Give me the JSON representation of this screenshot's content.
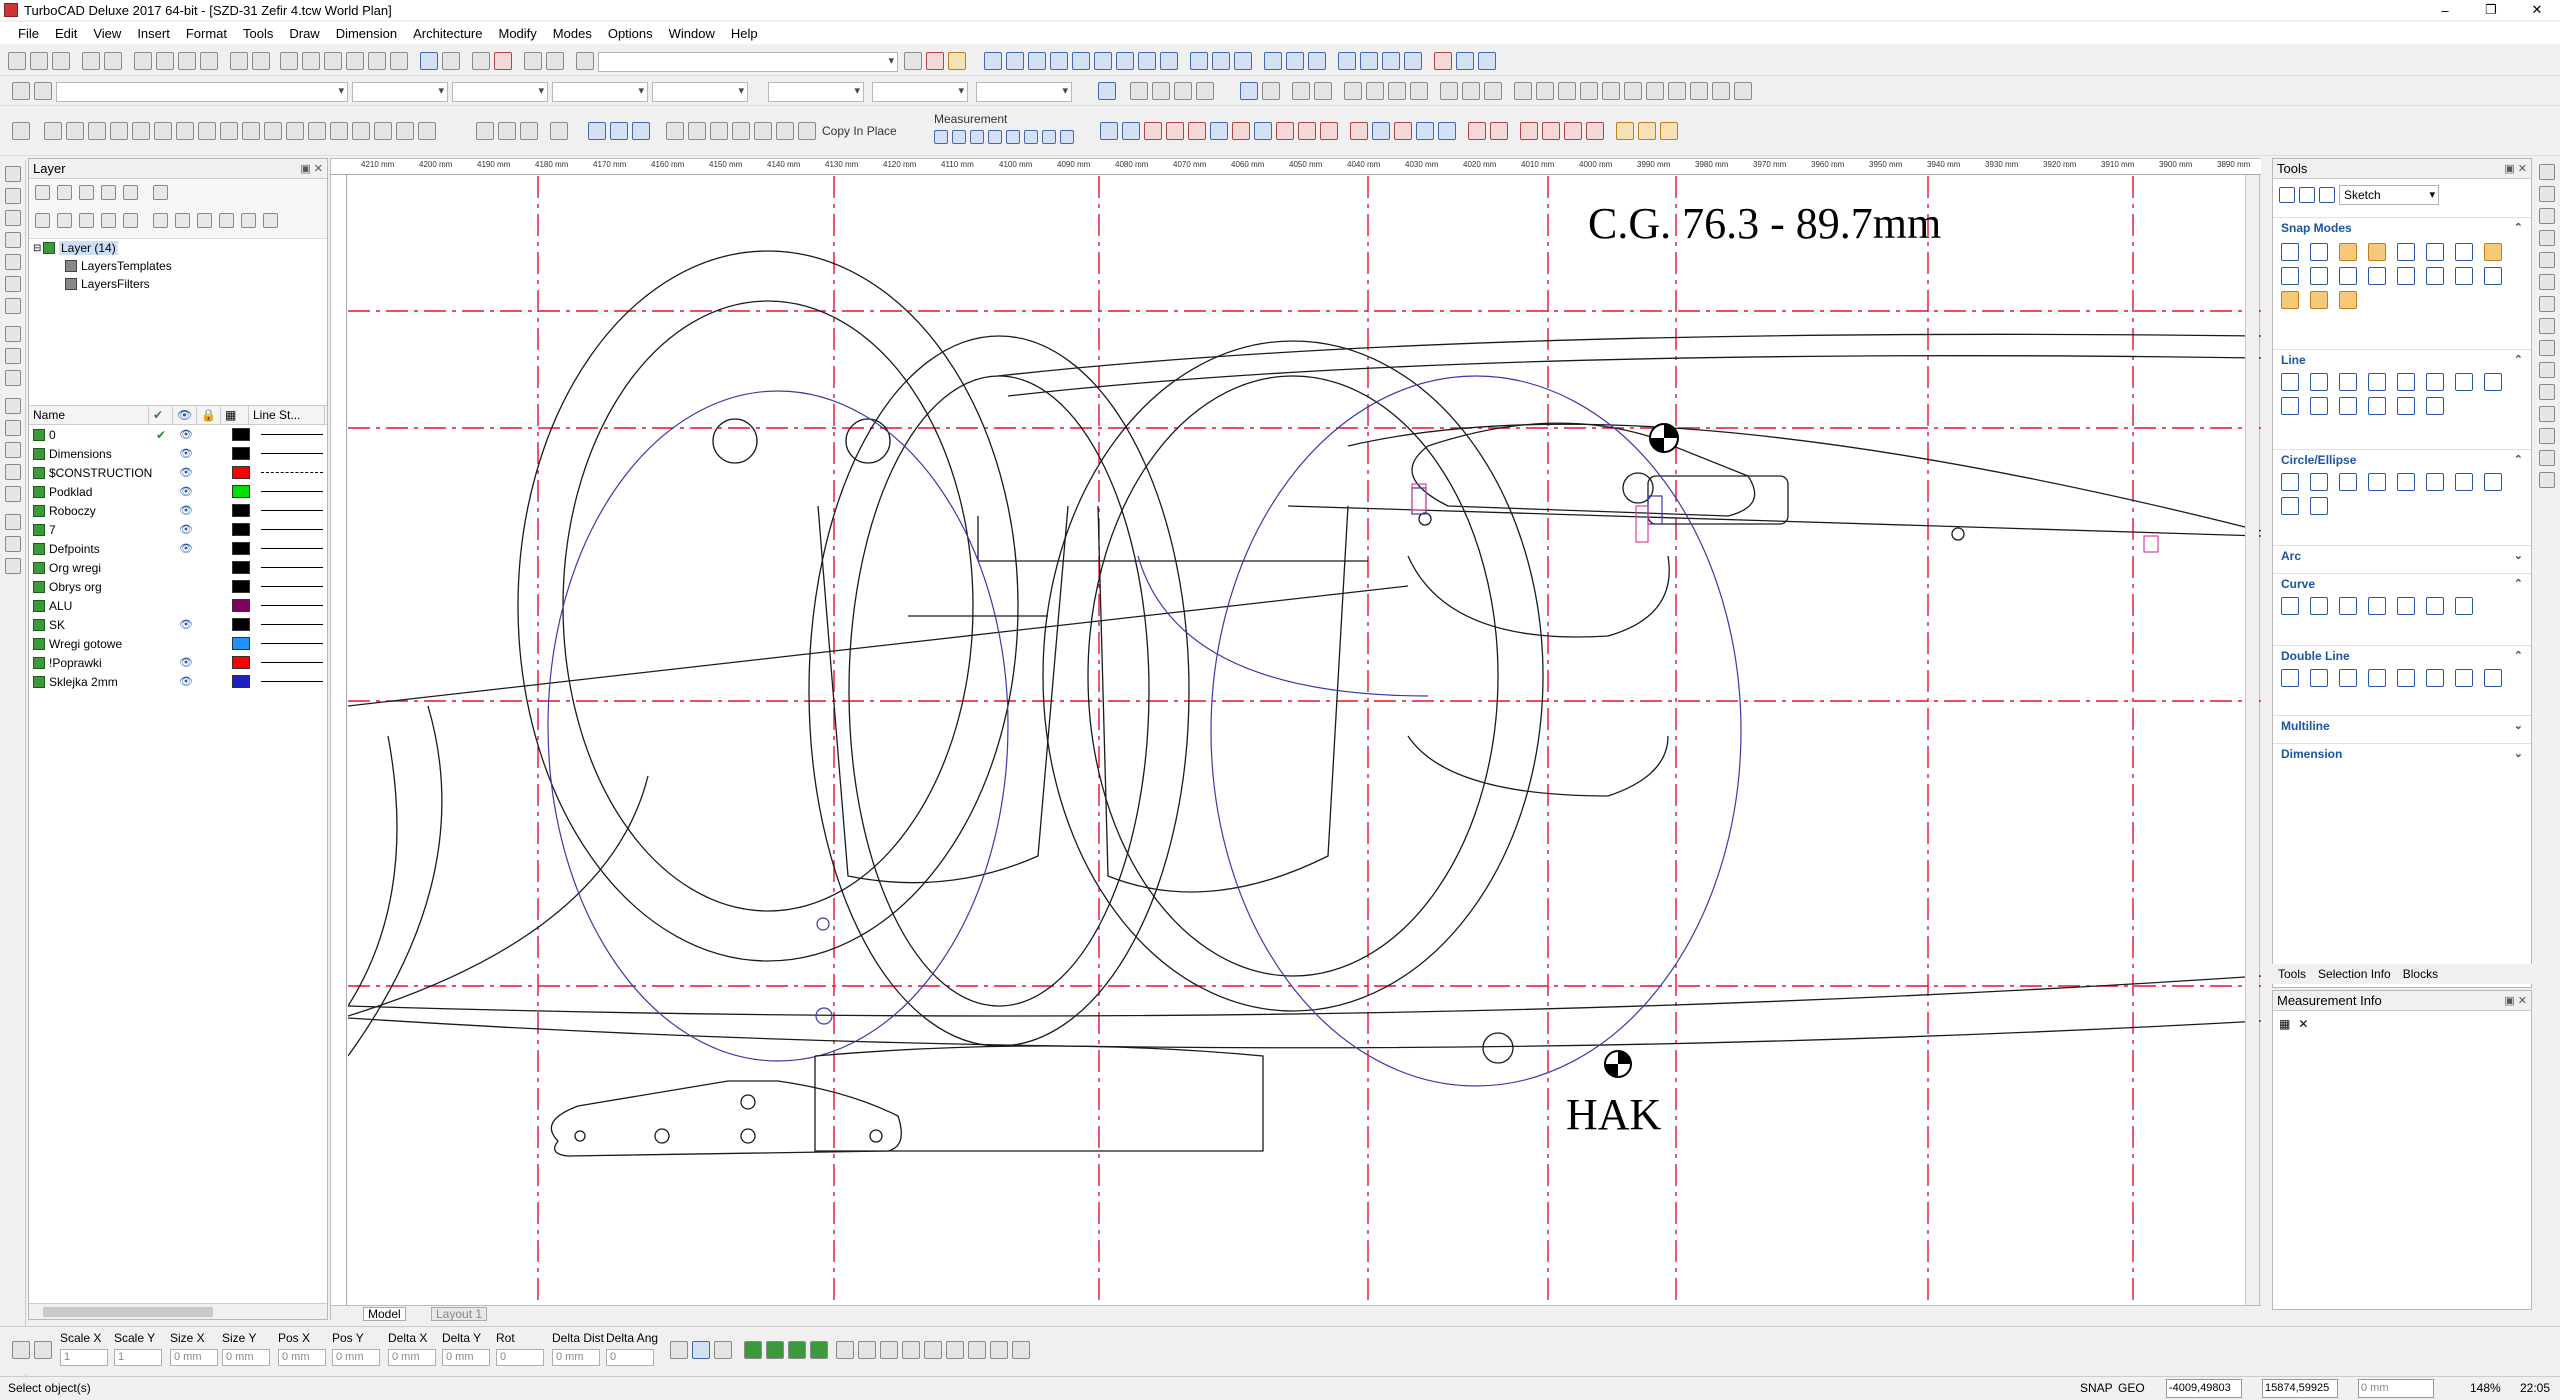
{
  "window": {
    "title": "TurboCAD Deluxe 2017 64-bit - [SZD-31 Zefir 4.tcw World Plan]",
    "controls": [
      "–",
      "❐",
      "✕"
    ]
  },
  "menu": [
    "File",
    "Edit",
    "View",
    "Insert",
    "Format",
    "Tools",
    "Draw",
    "Dimension",
    "Architecture",
    "Modify",
    "Modes",
    "Options",
    "Window",
    "Help"
  ],
  "toolbar": {
    "copy_in_place": "Copy In Place",
    "measurement": "Measurement"
  },
  "layer_panel": {
    "title": "Layer",
    "tree": [
      {
        "label": "Layer (14)",
        "selected": true
      },
      {
        "label": "LayersTemplates"
      },
      {
        "label": "LayersFilters"
      }
    ],
    "columns": {
      "name": "Name",
      "line_style": "Line St..."
    },
    "layers": [
      {
        "name": "0",
        "visible": true,
        "current": true,
        "color": "#000000",
        "style": "solid"
      },
      {
        "name": "Dimensions",
        "visible": true,
        "color": "#000000",
        "style": "solid"
      },
      {
        "name": "$CONSTRUCTION",
        "visible": true,
        "color": "#ff0000",
        "style": "dashdot"
      },
      {
        "name": "Podklad",
        "visible": true,
        "color": "#00e000",
        "style": "solid"
      },
      {
        "name": "Roboczy",
        "visible": true,
        "color": "#000000",
        "style": "solid"
      },
      {
        "name": "7",
        "visible": true,
        "color": "#000000",
        "style": "solid"
      },
      {
        "name": "Defpoints",
        "visible": true,
        "color": "#000000",
        "style": "solid"
      },
      {
        "name": "Org wregi",
        "visible": false,
        "color": "#000000",
        "style": "solid"
      },
      {
        "name": "Obrys org",
        "visible": false,
        "color": "#000000",
        "style": "solid"
      },
      {
        "name": "ALU",
        "visible": false,
        "color": "#800060",
        "style": "solid"
      },
      {
        "name": "SK",
        "visible": true,
        "color": "#000000",
        "style": "solid"
      },
      {
        "name": "Wregi gotowe",
        "visible": false,
        "color": "#1e90ff",
        "style": "solid"
      },
      {
        "name": "!Poprawki",
        "visible": true,
        "color": "#ff0000",
        "style": "solid"
      },
      {
        "name": "Sklejka 2mm",
        "visible": true,
        "color": "#2020c0",
        "style": "solid"
      }
    ]
  },
  "ruler": {
    "top_ticks": [
      "4210 mm",
      "4200 mm",
      "4190 mm",
      "4180 mm",
      "4170 mm",
      "4160 mm",
      "4150 mm",
      "4140 mm",
      "4130 mm",
      "4120 mm",
      "4110 mm",
      "4100 mm",
      "4090 mm",
      "4080 mm",
      "4070 mm",
      "4060 mm",
      "4050 mm",
      "4040 mm",
      "4030 mm",
      "4020 mm",
      "4010 mm",
      "4000 mm",
      "3990 mm",
      "3980 mm",
      "3970 mm",
      "3960 mm",
      "3950 mm",
      "3940 mm",
      "3930 mm",
      "3920 mm",
      "3910 mm",
      "3900 mm",
      "3890 mm"
    ]
  },
  "drawing": {
    "cg_label": "C.G. 76.3 - 89.7mm",
    "hak_label": "HAK"
  },
  "view_tabs": {
    "model": "Model",
    "layout": "Layout 1"
  },
  "tools_panel": {
    "title": "Tools",
    "mode": "Sketch",
    "sections": [
      "Snap Modes",
      "Line",
      "Circle/Ellipse",
      "Arc",
      "Curve",
      "Double Line",
      "Multiline",
      "Dimension"
    ],
    "tabs": [
      "Tools",
      "Selection Info",
      "Blocks"
    ]
  },
  "measurement_panel": {
    "title": "Measurement Info"
  },
  "inspector": {
    "fields": [
      {
        "label": "Scale X",
        "value": "1"
      },
      {
        "label": "Scale Y",
        "value": "1"
      },
      {
        "label": "Size X",
        "value": "0 mm"
      },
      {
        "label": "Size Y",
        "value": "0 mm"
      },
      {
        "label": "Pos X",
        "value": "0 mm"
      },
      {
        "label": "Pos Y",
        "value": "0 mm"
      },
      {
        "label": "Delta X",
        "value": "0 mm"
      },
      {
        "label": "Delta Y",
        "value": "0 mm"
      },
      {
        "label": "Rot",
        "value": "0"
      },
      {
        "label": "Delta Dist",
        "value": "0 mm"
      },
      {
        "label": "Delta Ang",
        "value": "0"
      }
    ]
  },
  "status": {
    "prompt": "Select object(s)",
    "snap": "SNAP",
    "geo": "GEO",
    "coord_x": "-4009,49803",
    "coord_y": "15874,59925",
    "coord_z": "0 mm",
    "zoom": "148%",
    "time": "22:05"
  },
  "colors": {
    "construction": "#e8112d",
    "geometry": "#1a1a1a",
    "plywood": "#3a3aa8",
    "accent": "#1a55a0"
  }
}
